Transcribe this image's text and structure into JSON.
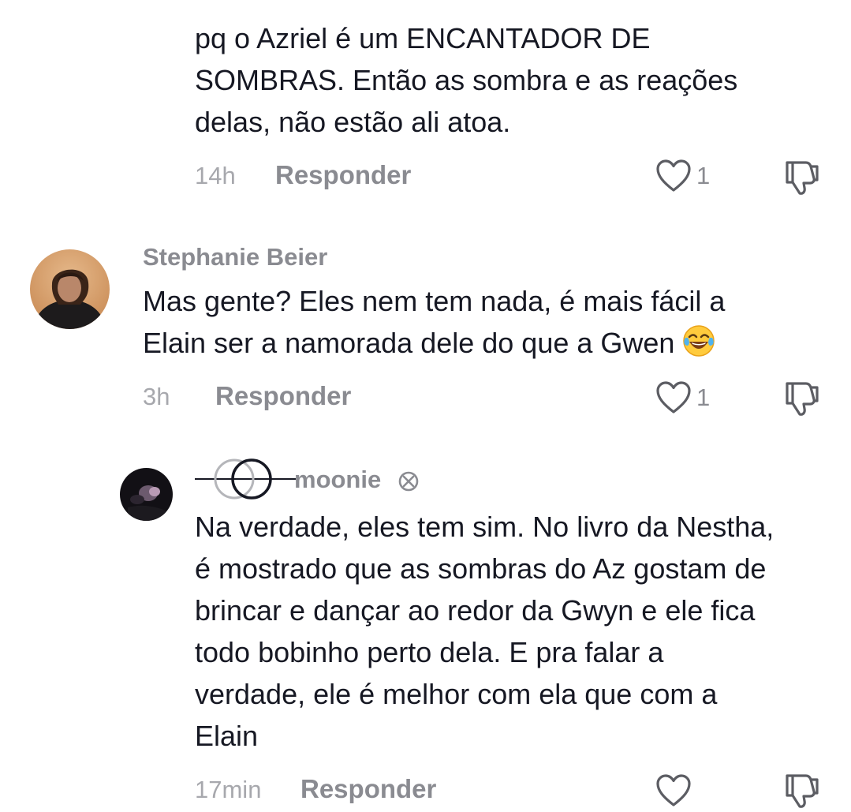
{
  "comments": [
    {
      "text": "pq o Azriel é um ENCANTADOR DE\nSOMBRAS. Então as sombra e as reações\ndelas, não estão ali atoa.",
      "time": "14h",
      "reply_label": "Responder",
      "likes": "1",
      "like_icon": "heart-outline-icon",
      "dislike_icon": "thumbs-down-icon"
    },
    {
      "username": "Stephanie Beier",
      "avatar_icon": "avatar",
      "text": "Mas gente? Eles nem tem nada, é mais fácil a\nElain ser a namorada dele do que a Gwen",
      "emoji": "face-with-tears-of-joy-icon",
      "time": "3h",
      "reply_label": "Responder",
      "likes": "1",
      "like_icon": "heart-outline-icon",
      "dislike_icon": "thumbs-down-icon"
    },
    {
      "username": "moonie",
      "username_icon": "interlocking-circles-icon",
      "username_suffix_icon": "x-circle-icon",
      "avatar_icon": "avatar",
      "text": "Na verdade, eles tem sim. No livro da Nestha,\né mostrado que as sombras do Az gostam de\nbrincar e dançar ao redor da Gwyn e ele fica\ntodo bobinho perto dela. E pra falar a\nverdade, ele é melhor com ela que com a\nElain",
      "time": "17min",
      "reply_label": "Responder",
      "likes": "",
      "like_icon": "heart-outline-icon",
      "dislike_icon": "thumbs-down-icon"
    }
  ],
  "colors": {
    "text": "#161823",
    "muted": "#8a8b91",
    "time": "#a7a8ad",
    "icon": "#5c5d63"
  }
}
